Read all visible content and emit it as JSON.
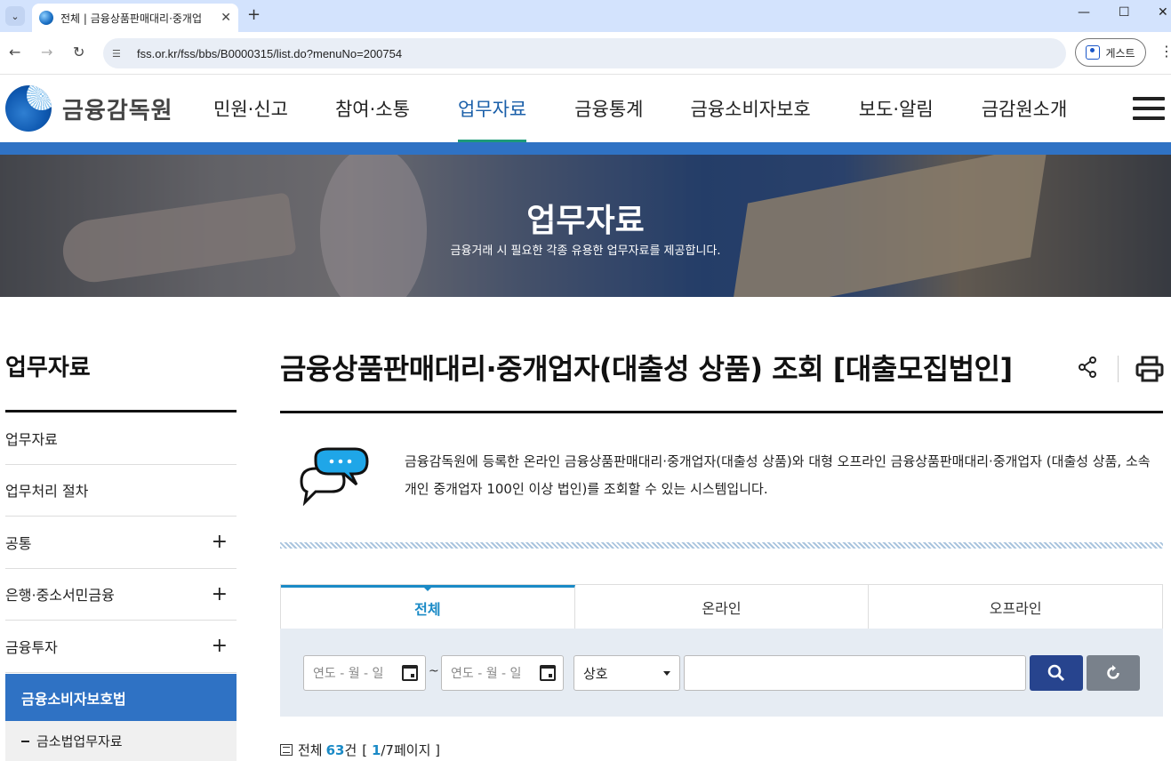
{
  "browser": {
    "tab_title": "전체 | 금융상품판매대리·중개업",
    "url": "fss.or.kr/fss/bbs/B0000315/list.do?menuNo=200754",
    "guest_label": "게스트"
  },
  "header": {
    "logo_text": "금융감독원",
    "nav": [
      "민원·신고",
      "참여·소통",
      "업무자료",
      "금융통계",
      "금융소비자보호",
      "보도·알림",
      "금감원소개"
    ],
    "active_nav": "업무자료"
  },
  "hero": {
    "title": "업무자료",
    "subtitle": "금융거래 시 필요한 각종 유용한 업무자료를 제공합니다."
  },
  "sidebar": {
    "title": "업무자료",
    "items": [
      {
        "label": "업무자료",
        "expandable": false
      },
      {
        "label": "업무처리 절차",
        "expandable": false
      },
      {
        "label": "공통",
        "expandable": true
      },
      {
        "label": "은행·중소서민금융",
        "expandable": true
      },
      {
        "label": "금융투자",
        "expandable": true
      }
    ],
    "active": "금융소비자보호법",
    "sub_item": "금소법업무자료"
  },
  "content": {
    "title": "금융상품판매대리·중개업자(대출성 상품) 조회 [대출모집법인]",
    "description": "금융감독원에 등록한 온라인 금융상품판매대리·중개업자(대출성 상품)와 대형 오프라인 금융상품판매대리·중개업자 (대출성 상품, 소속 개인 중개업자 100인 이상 법인)를 조회할 수 있는 시스템입니다.",
    "tabs": [
      "전체",
      "온라인",
      "오프라인"
    ],
    "active_tab": "전체",
    "search": {
      "date_from_placeholder": "연도 - 월 - 일",
      "date_to_placeholder": "연도 - 월 - 일",
      "tilde": "~",
      "select_value": "상호",
      "keyword_value": ""
    },
    "count": {
      "prefix": "전체",
      "total": "63",
      "unit": "건",
      "page_open": "[",
      "current_page": "1",
      "page_rest": "/7페이지",
      "page_close": "]"
    }
  }
}
